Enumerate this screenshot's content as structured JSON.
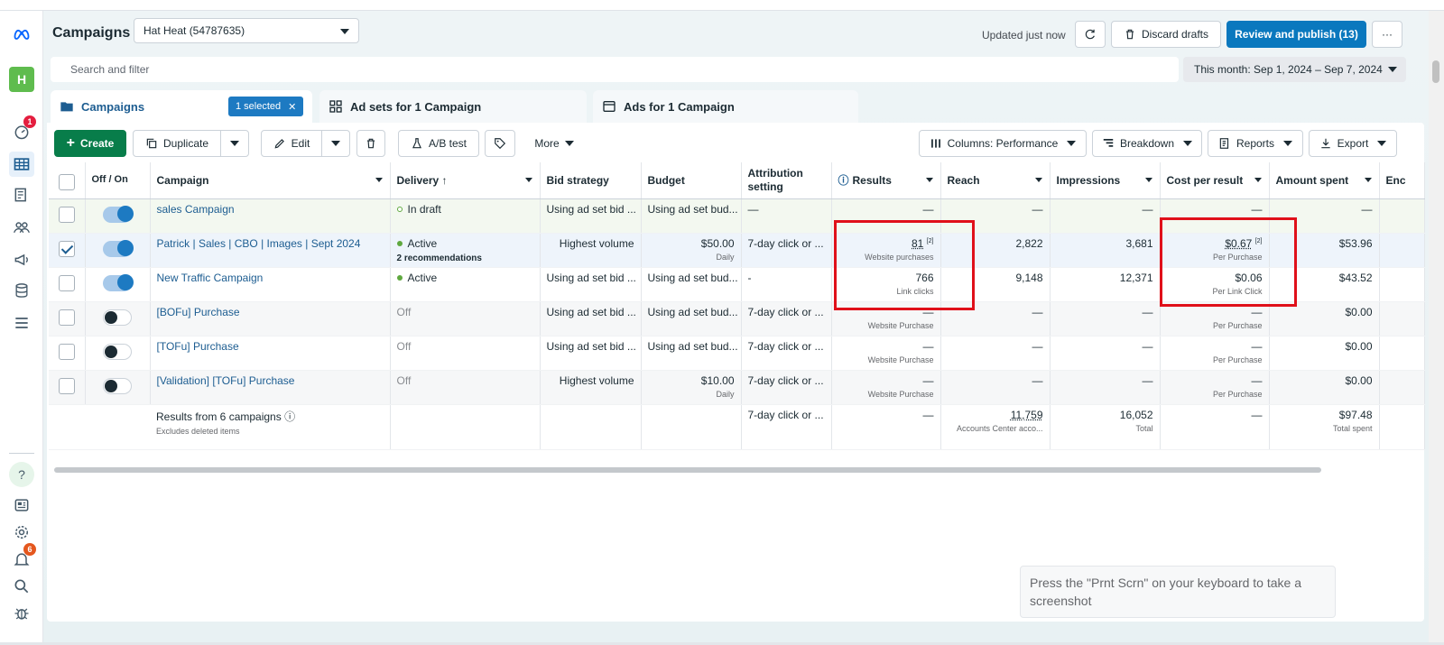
{
  "app": {
    "title": "Campaigns",
    "account": "Hat Heat (54787635)",
    "updated": "Updated just now",
    "discard": "Discard drafts",
    "publish": "Review and publish (13)",
    "more": "···"
  },
  "rail": {
    "avatar": "H",
    "badge_top": "1",
    "badge_bell": "6",
    "help": "?"
  },
  "search": {
    "placeholder": "Search and filter"
  },
  "daterange": "This month: Sep 1, 2024 – Sep 7, 2024",
  "tabs": {
    "campaigns": "Campaigns",
    "selected": "1 selected",
    "adsets": "Ad sets for 1 Campaign",
    "ads": "Ads for 1 Campaign"
  },
  "toolbar": {
    "create": "Create",
    "duplicate": "Duplicate",
    "edit": "Edit",
    "ab": "A/B test",
    "more": "More",
    "columns": "Columns: Performance",
    "breakdown": "Breakdown",
    "reports": "Reports",
    "export": "Export"
  },
  "headers": {
    "off_on": "Off / On",
    "campaign": "Campaign",
    "delivery": "Delivery ↑",
    "bid": "Bid strategy",
    "budget": "Budget",
    "attribution": "Attribution setting",
    "results": "Results",
    "reach": "Reach",
    "impressions": "Impressions",
    "cpr": "Cost per result",
    "spent": "Amount spent",
    "ends": "Enc"
  },
  "rows": [
    {
      "name": "sales Campaign",
      "delivery": "In draft",
      "bid": "Using ad set bid ...",
      "budget": "Using ad set bud...",
      "budget_sub": "",
      "attr": "—",
      "results": "—",
      "results_sub": "",
      "reach": "—",
      "impr": "—",
      "cpr": "—",
      "cpr_sub": "",
      "spent": "—",
      "checked": false,
      "on": true
    },
    {
      "name": "Patrick | Sales | CBO | Images | Sept 2024",
      "delivery": "Active",
      "recs": "2 recommendations",
      "bid": "Highest volume",
      "budget": "$50.00",
      "budget_sub": "Daily",
      "attr": "7-day click or ...",
      "results": "81",
      "results_sup": "[2]",
      "results_sub": "Website purchases",
      "reach": "2,822",
      "impr": "3,681",
      "cpr": "$0.67",
      "cpr_sup": "[2]",
      "cpr_sub": "Per Purchase",
      "spent": "$53.96",
      "checked": true,
      "on": true
    },
    {
      "name": "New Traffic Campaign",
      "delivery": "Active",
      "bid": "Using ad set bid ...",
      "budget": "Using ad set bud...",
      "budget_sub": "",
      "attr": "-",
      "results": "766",
      "results_sub": "Link clicks",
      "reach": "9,148",
      "impr": "12,371",
      "cpr": "$0.06",
      "cpr_sub": "Per Link Click",
      "spent": "$43.52",
      "checked": false,
      "on": true
    },
    {
      "name": "[BOFu] Purchase",
      "delivery": "Off",
      "bid": "Using ad set bid ...",
      "budget": "Using ad set bud...",
      "budget_sub": "",
      "attr": "7-day click or ...",
      "results": "—",
      "results_sub": "Website Purchase",
      "reach": "—",
      "impr": "—",
      "cpr": "—",
      "cpr_sub": "Per Purchase",
      "spent": "$0.00",
      "checked": false,
      "on": false
    },
    {
      "name": "[TOFu] Purchase",
      "delivery": "Off",
      "bid": "Using ad set bid ...",
      "budget": "Using ad set bud...",
      "budget_sub": "",
      "attr": "7-day click or ...",
      "results": "—",
      "results_sub": "Website Purchase",
      "reach": "—",
      "impr": "—",
      "cpr": "—",
      "cpr_sub": "Per Purchase",
      "spent": "$0.00",
      "checked": false,
      "on": false
    },
    {
      "name": "[Validation] [TOFu] Purchase",
      "delivery": "Off",
      "bid": "Highest volume",
      "budget": "$10.00",
      "budget_sub": "Daily",
      "attr": "7-day click or ...",
      "results": "—",
      "results_sub": "Website Purchase",
      "reach": "—",
      "impr": "—",
      "cpr": "—",
      "cpr_sub": "Per Purchase",
      "spent": "$0.00",
      "checked": false,
      "on": false
    }
  ],
  "totals": {
    "label": "Results from 6 campaigns",
    "sub": "Excludes deleted items",
    "attr": "7-day click or ...",
    "results": "—",
    "reach": "11,759",
    "reach_sub": "Accounts Center acco...",
    "impr": "16,052",
    "impr_sub": "Total",
    "cpr": "—",
    "spent": "$97.48",
    "spent_sub": "Total spent"
  },
  "toast": "Press the \"Prnt Scrn\" on your keyboard to take a screenshot",
  "colors": {
    "accent": "#0a78be",
    "create": "#087d4a",
    "highlight": "#e0101a"
  }
}
